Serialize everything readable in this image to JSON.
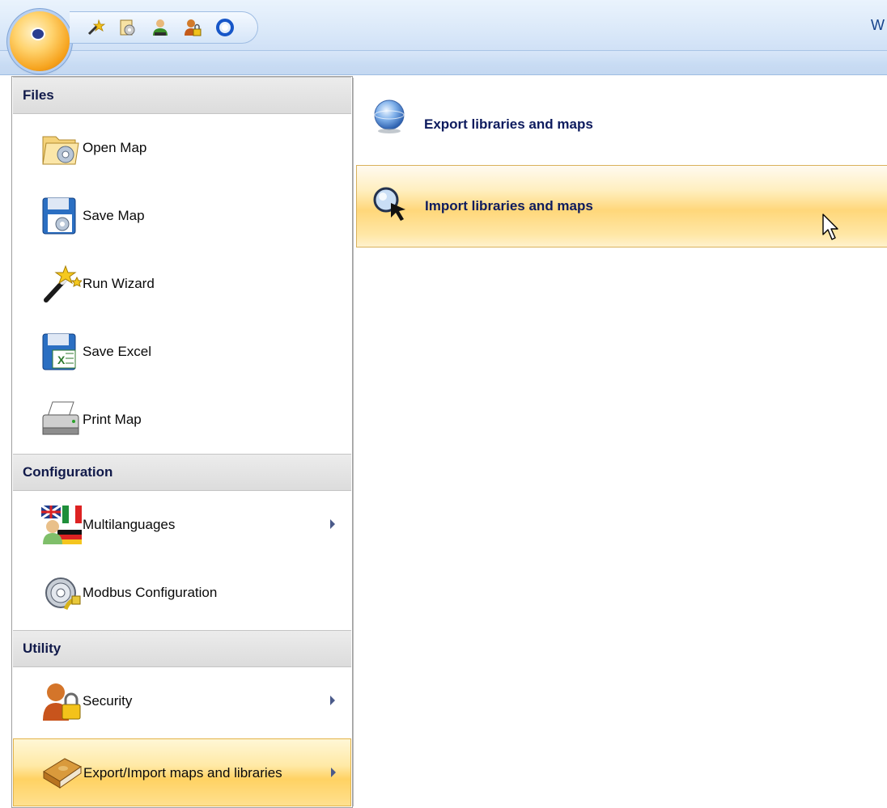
{
  "window": {
    "title_fragment": "W"
  },
  "quick_access": {
    "buttons": [
      "wand-icon",
      "settings-page-icon",
      "user-green-icon",
      "user-lock-icon",
      "ring-icon"
    ]
  },
  "menu": {
    "sections": [
      {
        "title": "Files",
        "items": [
          {
            "label": "Open Map",
            "icon": "open-folder-gear-icon",
            "has_submenu": false
          },
          {
            "label": "Save Map",
            "icon": "floppy-gear-icon",
            "has_submenu": false
          },
          {
            "label": "Run Wizard",
            "icon": "magic-wand-icon",
            "has_submenu": false
          },
          {
            "label": "Save Excel",
            "icon": "floppy-excel-icon",
            "has_submenu": false
          },
          {
            "label": "Print Map",
            "icon": "printer-icon",
            "has_submenu": false
          }
        ]
      },
      {
        "title": "Configuration",
        "items": [
          {
            "label": "Multilanguages",
            "icon": "flags-user-icon",
            "has_submenu": true
          },
          {
            "label": "Modbus Configuration",
            "icon": "gear-cable-icon",
            "has_submenu": false
          }
        ]
      },
      {
        "title": "Utility",
        "items": [
          {
            "label": "Security",
            "icon": "user-padlock-icon",
            "has_submenu": true
          },
          {
            "label": "Export/Import maps and libraries",
            "icon": "book-icon",
            "has_submenu": true,
            "selected": true
          }
        ]
      }
    ]
  },
  "submenu": {
    "items": [
      {
        "label": "Export libraries and maps",
        "icon": "globe-export-icon"
      },
      {
        "label": "Import libraries and maps",
        "icon": "magnifier-import-icon",
        "hovered": true
      }
    ]
  },
  "colors": {
    "ribbon": "#dbe9f9",
    "highlight": "#ffd263",
    "header_text": "#111a4a",
    "submenu_text": "#0d1b5e"
  }
}
